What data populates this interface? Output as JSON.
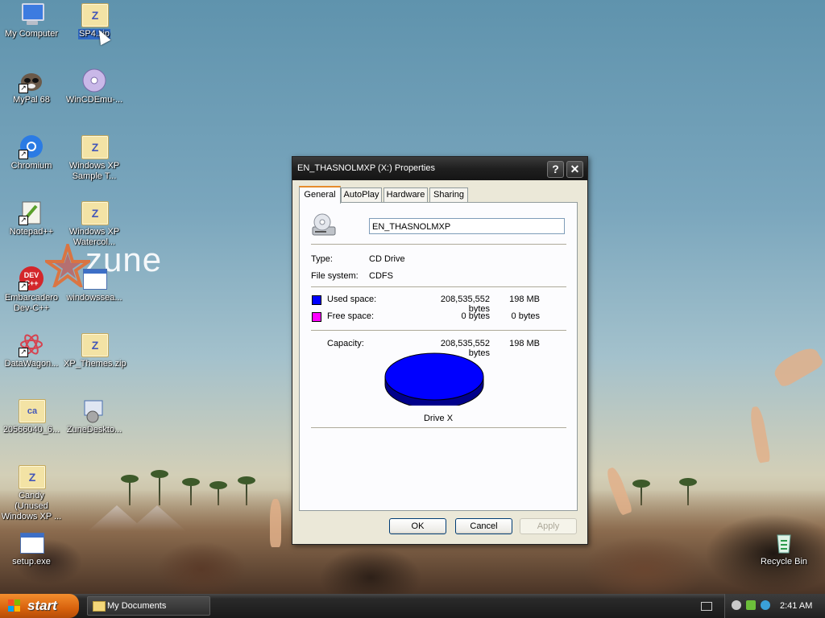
{
  "desktop": {
    "watermark": "zune",
    "icons": [
      {
        "label": "My Computer",
        "icon": "computer-icon"
      },
      {
        "label": "SP4.zip",
        "icon": "zip-folder-icon"
      },
      {
        "label": "MyPal 68",
        "icon": "raccoon-icon"
      },
      {
        "label": "WinCDEmu-...",
        "icon": "disc-icon"
      },
      {
        "label": "Chromium",
        "icon": "chromium-icon"
      },
      {
        "label": "Windows XP Sample T...",
        "icon": "zip-folder-icon"
      },
      {
        "label": "Notepad++",
        "icon": "notepad-icon"
      },
      {
        "label": "Windows XP Watercol...",
        "icon": "zip-folder-icon"
      },
      {
        "label": "Embarcadero Dev-C++",
        "icon": "devcpp-icon"
      },
      {
        "label": "windowssea...",
        "icon": "window-icon"
      },
      {
        "label": "DataWagon...",
        "icon": "flower-icon"
      },
      {
        "label": "XP_Themes.zip",
        "icon": "zip-folder-icon"
      },
      {
        "label": "20566040_6...",
        "icon": "cab-folder-icon"
      },
      {
        "label": "ZuneDeskto...",
        "icon": "installer-icon"
      },
      {
        "label": "Candy (Unused Windows XP ...",
        "icon": "zip-folder-icon"
      },
      {
        "label": "setup.exe",
        "icon": "window-icon"
      },
      {
        "label": "Recycle Bin",
        "icon": "recycle-bin-icon"
      }
    ]
  },
  "dialog": {
    "title": "EN_THASNOLMXP (X:) Properties",
    "help_btn": "?",
    "close_btn": "✕",
    "tabs": [
      "General",
      "AutoPlay",
      "Hardware",
      "Sharing"
    ],
    "drive_name": "EN_THASNOLMXP",
    "type_label": "Type:",
    "type_value": "CD Drive",
    "fs_label": "File system:",
    "fs_value": "CDFS",
    "used_label": "Used space:",
    "used_bytes": "208,535,552 bytes",
    "used_mb": "198 MB",
    "free_label": "Free space:",
    "free_bytes": "0 bytes",
    "free_mb": "0 bytes",
    "capacity_label": "Capacity:",
    "capacity_bytes": "208,535,552 bytes",
    "capacity_mb": "198 MB",
    "pie_label": "Drive X",
    "used_color": "#0000ff",
    "free_color": "#ff00ff",
    "ok": "OK",
    "cancel": "Cancel",
    "apply": "Apply"
  },
  "taskbar": {
    "start": "start",
    "task": "My Documents",
    "clock": "2:41 AM"
  }
}
